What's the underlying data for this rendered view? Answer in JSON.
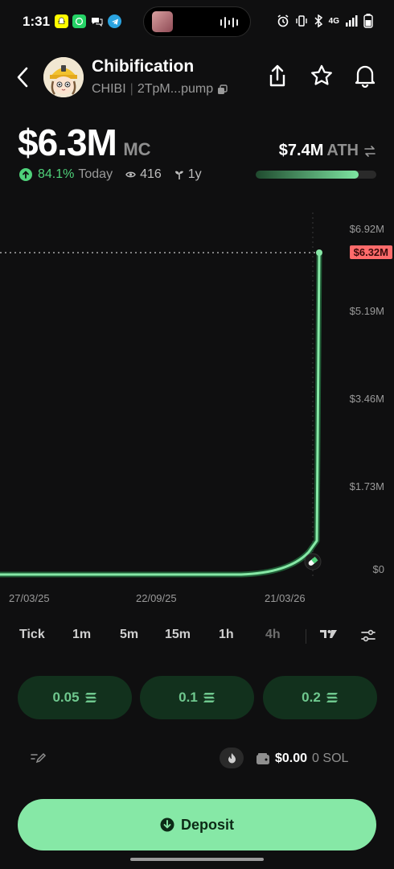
{
  "status_bar": {
    "time": "1:31",
    "network": "4G"
  },
  "token": {
    "name": "Chibification",
    "ticker": "CHIBI",
    "address_short": "2TpM...pump"
  },
  "market": {
    "market_cap": "$6.3M",
    "mc_label": "MC",
    "change_pct": "84.1%",
    "change_period": "Today",
    "viewers": "416",
    "age": "1y",
    "ath_value": "$7.4M",
    "ath_label": "ATH",
    "ath_progress": 0.85
  },
  "chart": {
    "y_labels": [
      "$6.92M",
      "$5.19M",
      "$3.46M",
      "$1.73M",
      "$0"
    ],
    "current_price_tag": "$6.32M",
    "x_labels": [
      "27/03/25",
      "22/09/25",
      "21/03/26"
    ]
  },
  "timeframes": [
    "Tick",
    "1m",
    "5m",
    "15m",
    "1h",
    "4h"
  ],
  "quick_buys": [
    "0.05",
    "0.1",
    "0.2"
  ],
  "wallet": {
    "balance_usd": "$0.00",
    "balance_sol": "0 SOL"
  },
  "deposit_label": "Deposit",
  "colors": {
    "accent": "#86e8a6",
    "positive": "#4fd27a",
    "price_tag": "#ff6b6b",
    "background": "#0f0f10"
  }
}
